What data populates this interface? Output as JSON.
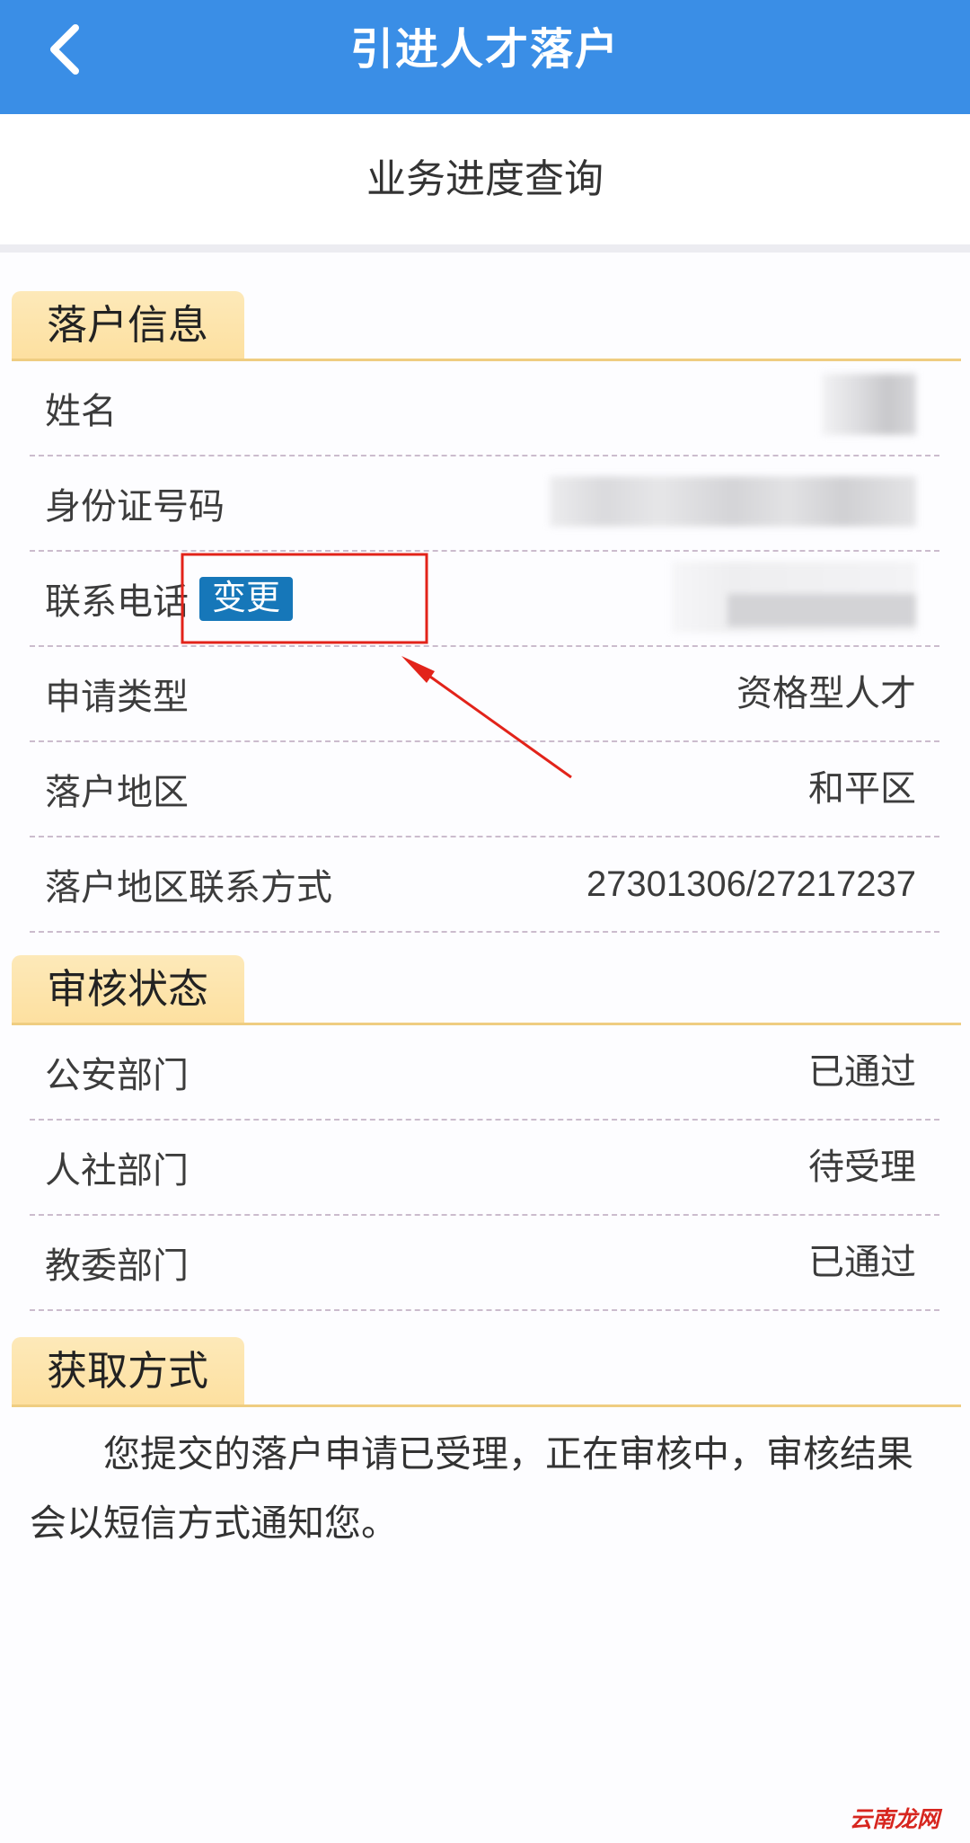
{
  "header": {
    "title": "引进人才落户",
    "back_icon": "chevron-left-icon"
  },
  "page_subtitle": "业务进度查询",
  "settlement_info": {
    "title": "落户信息",
    "rows": [
      {
        "label": "姓名"
      },
      {
        "label": "身份证号码"
      },
      {
        "label": "联系电话",
        "action_label": "变更"
      },
      {
        "label": "申请类型",
        "value": "资格型人才"
      },
      {
        "label": "落户地区",
        "value": "和平区"
      },
      {
        "label": "落户地区联系方式",
        "value": "27301306/27217237"
      }
    ]
  },
  "review_status": {
    "title": "审核状态",
    "rows": [
      {
        "label": "公安部门",
        "value": "已通过"
      },
      {
        "label": "人社部门",
        "value": "待受理"
      },
      {
        "label": "教委部门",
        "value": "已通过"
      }
    ]
  },
  "retrieval_method": {
    "title": "获取方式",
    "text": "您提交的落户申请已受理，正在审核中，审核结果会以短信方式通知您。"
  },
  "watermark": "云南龙网",
  "colors": {
    "header": "#3a8ee6",
    "badge": "#1677b9",
    "tab": "#fde0a0",
    "tab_rule": "#efcd81",
    "annotation": "#e2231a",
    "watermark": "#d7261f"
  }
}
